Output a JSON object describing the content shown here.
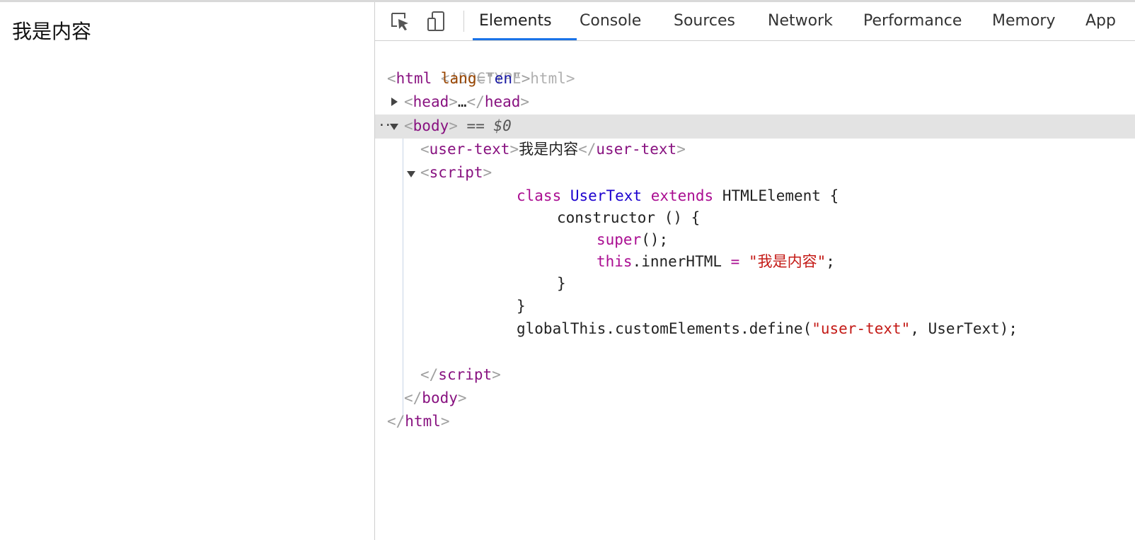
{
  "page": {
    "content_text": "我是内容"
  },
  "devtools": {
    "tabs": [
      "Elements",
      "Console",
      "Sources",
      "Network",
      "Performance",
      "Memory",
      "App"
    ],
    "active_tab": "Elements",
    "tools": {
      "inspect_icon": "inspect-element-icon",
      "device_icon": "device-toolbar-icon"
    },
    "selection_marker": "== $0",
    "dom": {
      "doctype": "<!DOCTYPE html>",
      "html_open_tag": "html",
      "html_lang_attr": "lang",
      "html_lang_value": "en",
      "head_tag": "head",
      "head_ellipsis": "…",
      "body_tag": "body",
      "user_text_tag": "user-text",
      "user_text_content": "我是内容",
      "script_tag": "script",
      "code": {
        "l1_kw_class": "class",
        "l1_name": "UserText",
        "l1_kw_extends": "extends",
        "l1_base": "HTMLElement {",
        "l2": "constructor () {",
        "l3_super": "super",
        "l3_rest": "();",
        "l4_this": "this",
        "l4_prop": ".innerHTML",
        "l4_eq": "=",
        "l4_str": "\"我是内容\"",
        "l4_end": ";",
        "l5": "}",
        "l6": "}",
        "l7_pre": "globalThis.customElements.define(",
        "l7_str": "\"user-text\"",
        "l7_post": ", UserText);"
      }
    }
  },
  "colors": {
    "tag": "#881280",
    "attr": "#994500",
    "attr_value": "#1a1aa6",
    "keyword": "#aa0d91",
    "string": "#c41a16",
    "active_tab_underline": "#1a73e8",
    "selected_row": "#e3e3e3"
  }
}
